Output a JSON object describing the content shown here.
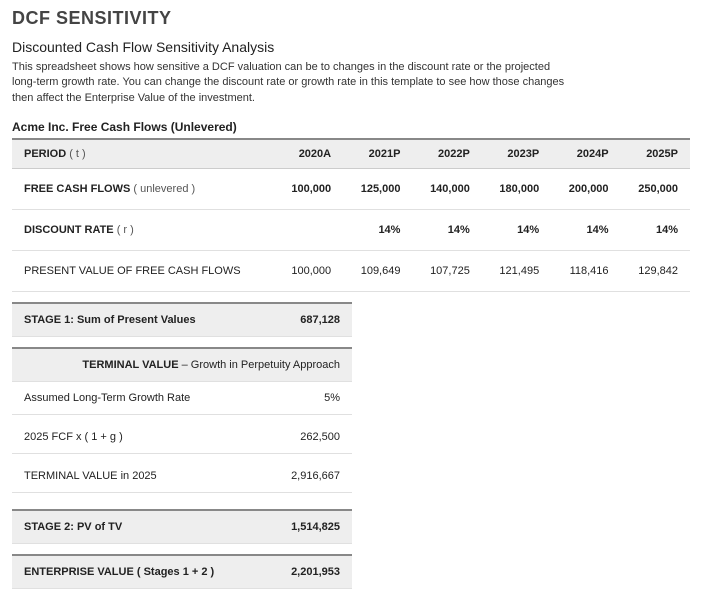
{
  "header": {
    "title": "DCF SENSITIVITY",
    "subtitle": "Discounted Cash Flow Sensitivity Analysis",
    "description": "This spreadsheet shows how sensitive a DCF valuation can be to changes in the discount rate or the projected long-term growth rate. You can change the discount rate or growth rate in this template to see how those changes then affect the Enterprise Value of the investment.",
    "section_title": "Acme Inc. Free Cash Flows (Unlevered)"
  },
  "table1": {
    "cols": [
      "PERIOD",
      "2020A",
      "2021P",
      "2022P",
      "2023P",
      "2024P",
      "2025P"
    ],
    "period_unit": "( t )",
    "rows": [
      {
        "label": "FREE CASH FLOWS",
        "label_sub": "( unlevered )",
        "bold": true,
        "cells": [
          "100,000",
          "125,000",
          "140,000",
          "180,000",
          "200,000",
          "250,000"
        ]
      },
      {
        "label": "DISCOUNT RATE",
        "label_sub": "( r )",
        "bold": true,
        "cells": [
          "",
          "14%",
          "14%",
          "14%",
          "14%",
          "14%"
        ]
      },
      {
        "label": "PRESENT VALUE OF FREE CASH FLOWS",
        "label_sub": "",
        "bold": false,
        "cells": [
          "100,000",
          "109,649",
          "107,725",
          "121,495",
          "118,416",
          "129,842"
        ]
      }
    ]
  },
  "stage1": {
    "label": "STAGE 1: Sum of Present Values",
    "value": "687,128"
  },
  "terminal": {
    "header_bold": "TERMINAL VALUE",
    "header_rest": " – Growth in Perpetuity Approach",
    "rows": [
      {
        "label": "Assumed Long-Term Growth Rate",
        "value": "5%"
      },
      {
        "label": "2025 FCF x ( 1 + g )",
        "value": "262,500"
      },
      {
        "label": "TERMINAL VALUE in 2025",
        "value": "2,916,667"
      }
    ]
  },
  "stage2": {
    "label": "STAGE 2: PV of TV",
    "value": "1,514,825"
  },
  "ev": {
    "label": "ENTERPRISE VALUE  ( Stages 1 + 2 )",
    "value": "2,201,953"
  }
}
